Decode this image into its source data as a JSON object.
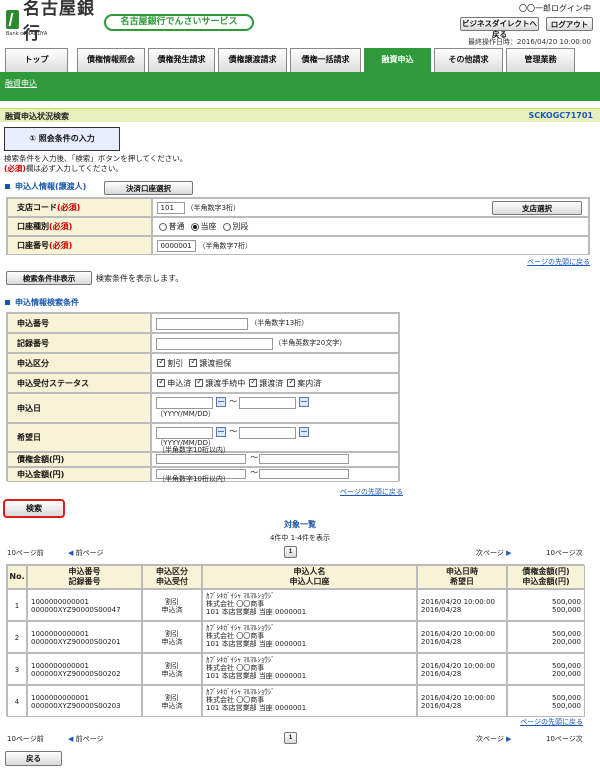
{
  "brand": {
    "bank_name": "名古屋銀行",
    "logo_sub": "Bank of NAGOYA",
    "service_name": "名古屋銀行でんさいサービス"
  },
  "header": {
    "user": "〇〇一郎ログイン中",
    "return_button": "ビジネスダイレクトへ戻る",
    "logout_button": "ログアウト",
    "last_operation": "最終操作日時：2016/04/20 10:00:00"
  },
  "tabs": [
    "トップ",
    "債権情報照会",
    "債権発生請求",
    "債権譲渡請求",
    "債権一括請求",
    "融資申込",
    "その他請求",
    "管理業務"
  ],
  "subnav": {
    "link": "融資申込"
  },
  "page": {
    "title": "融資申込状況検索",
    "code": "SCKOGC71701"
  },
  "step": {
    "label": "① 照会条件の入力"
  },
  "instructions": {
    "line1": "検索条件を入力後、「検索」ボタンを押してください。",
    "line2_req": "(必須)",
    "line2_text": "欄は必ず入力してください。"
  },
  "applicant": {
    "section_title": "申込人情報(譲渡人)",
    "select_button": "決済口座選択",
    "branch_label": "支店コード",
    "branch_required": "(必須)",
    "branch_value": "101",
    "branch_hint": "（半角数字3桁）",
    "branch_button": "支店選択",
    "account_type_label": "口座種別",
    "account_type_required": "(必須)",
    "account_types": [
      "普通",
      "当座",
      "別段"
    ],
    "account_number_label": "口座番号",
    "account_number_required": "(必須)",
    "account_number_value": "0000001",
    "account_number_hint": "（半角数字7桁）",
    "top_link": "ページの先頭に戻る"
  },
  "search_toggle": {
    "button": "検索条件非表示",
    "text": "検索条件を表示します。"
  },
  "conditions": {
    "section_title": "申込情報検索条件",
    "application_no": "申込番号",
    "application_no_hint": "（半角数字13桁）",
    "record_no": "記録番号",
    "record_no_hint": "（半角英数字20文字）",
    "application_type": "申込区分",
    "types": [
      "割引",
      "譲渡担保"
    ],
    "status": "申込受付ステータス",
    "statuses": [
      "申込済",
      "譲渡手続中",
      "譲渡済",
      "案内済"
    ],
    "application_date": "申込日",
    "desired_date": "希望日",
    "date_hint": "（YYYY/MM/DD）",
    "claim_amount": "債権金額(円)",
    "apply_amount": "申込金額(円)",
    "amount_hint": "（半角数字10桁以内）",
    "tilde": "～",
    "top_link": "ページの先頭に戻る"
  },
  "search_button": "検索",
  "results": {
    "title": "対象一覧",
    "count": "4件中 1-4件を表示",
    "prev10": "10ページ前",
    "prev": "前ページ",
    "page": "1",
    "next": "次ページ",
    "next10": "10ページ次",
    "top_link": "ページの先頭に戻る",
    "back_button": "戻る",
    "headers": {
      "no": "No.",
      "nums": [
        "申込番号",
        "記録番号"
      ],
      "type": [
        "申込区分",
        "申込受付"
      ],
      "name": [
        "申込人名",
        "申込人口座"
      ],
      "dates": [
        "申込日時",
        "希望日"
      ],
      "amounts": [
        "債権金額(円)",
        "申込金額(円)"
      ]
    },
    "rows": [
      {
        "no": "1",
        "app": "1000000000001",
        "rec": "000000XYZ90000S00047",
        "type1": "割引",
        "type2": "申込済",
        "kana": "ｶﾌﾞｼｷｶﾞｲｼｬ ﾏﾙﾏﾙｼｮｳｼﾞ",
        "corp": "株式会社 〇〇商事",
        "acct": "101 本店営業部 当座 0000001",
        "date1": "2016/04/20 10:00:00",
        "date2": "2016/04/28",
        "amt1": "500,000",
        "amt2": "500,000"
      },
      {
        "no": "2",
        "app": "1000000000001",
        "rec": "000000XYZ90000S00201",
        "type1": "割引",
        "type2": "申込済",
        "kana": "ｶﾌﾞｼｷｶﾞｲｼｬ ﾏﾙﾏﾙｼｮｳｼﾞ",
        "corp": "株式会社 〇〇商事",
        "acct": "101 本店営業部 当座 0000001",
        "date1": "2016/04/20 10:00:00",
        "date2": "2016/04/28",
        "amt1": "500,000",
        "amt2": "200,000"
      },
      {
        "no": "3",
        "app": "1000000000001",
        "rec": "000000XYZ90000S00202",
        "type1": "割引",
        "type2": "申込済",
        "kana": "ｶﾌﾞｼｷｶﾞｲｼｬ ﾏﾙﾏﾙｼｮｳｼﾞ",
        "corp": "株式会社 〇〇商事",
        "acct": "101 本店営業部 当座 0000001",
        "date1": "2016/04/20 10:00:00",
        "date2": "2016/04/28",
        "amt1": "500,000",
        "amt2": "200,000"
      },
      {
        "no": "4",
        "app": "1000000000001",
        "rec": "000000XYZ90000S00203",
        "type1": "割引",
        "type2": "申込済",
        "kana": "ｶﾌﾞｼｷｶﾞｲｼｬ ﾏﾙﾏﾙｼｮｳｼﾞ",
        "corp": "株式会社 〇〇商事",
        "acct": "101 本店営業部 当座 0000001",
        "date1": "2016/04/20 10:00:00",
        "date2": "2016/04/28",
        "amt1": "500,000",
        "amt2": "500,000"
      }
    ]
  }
}
